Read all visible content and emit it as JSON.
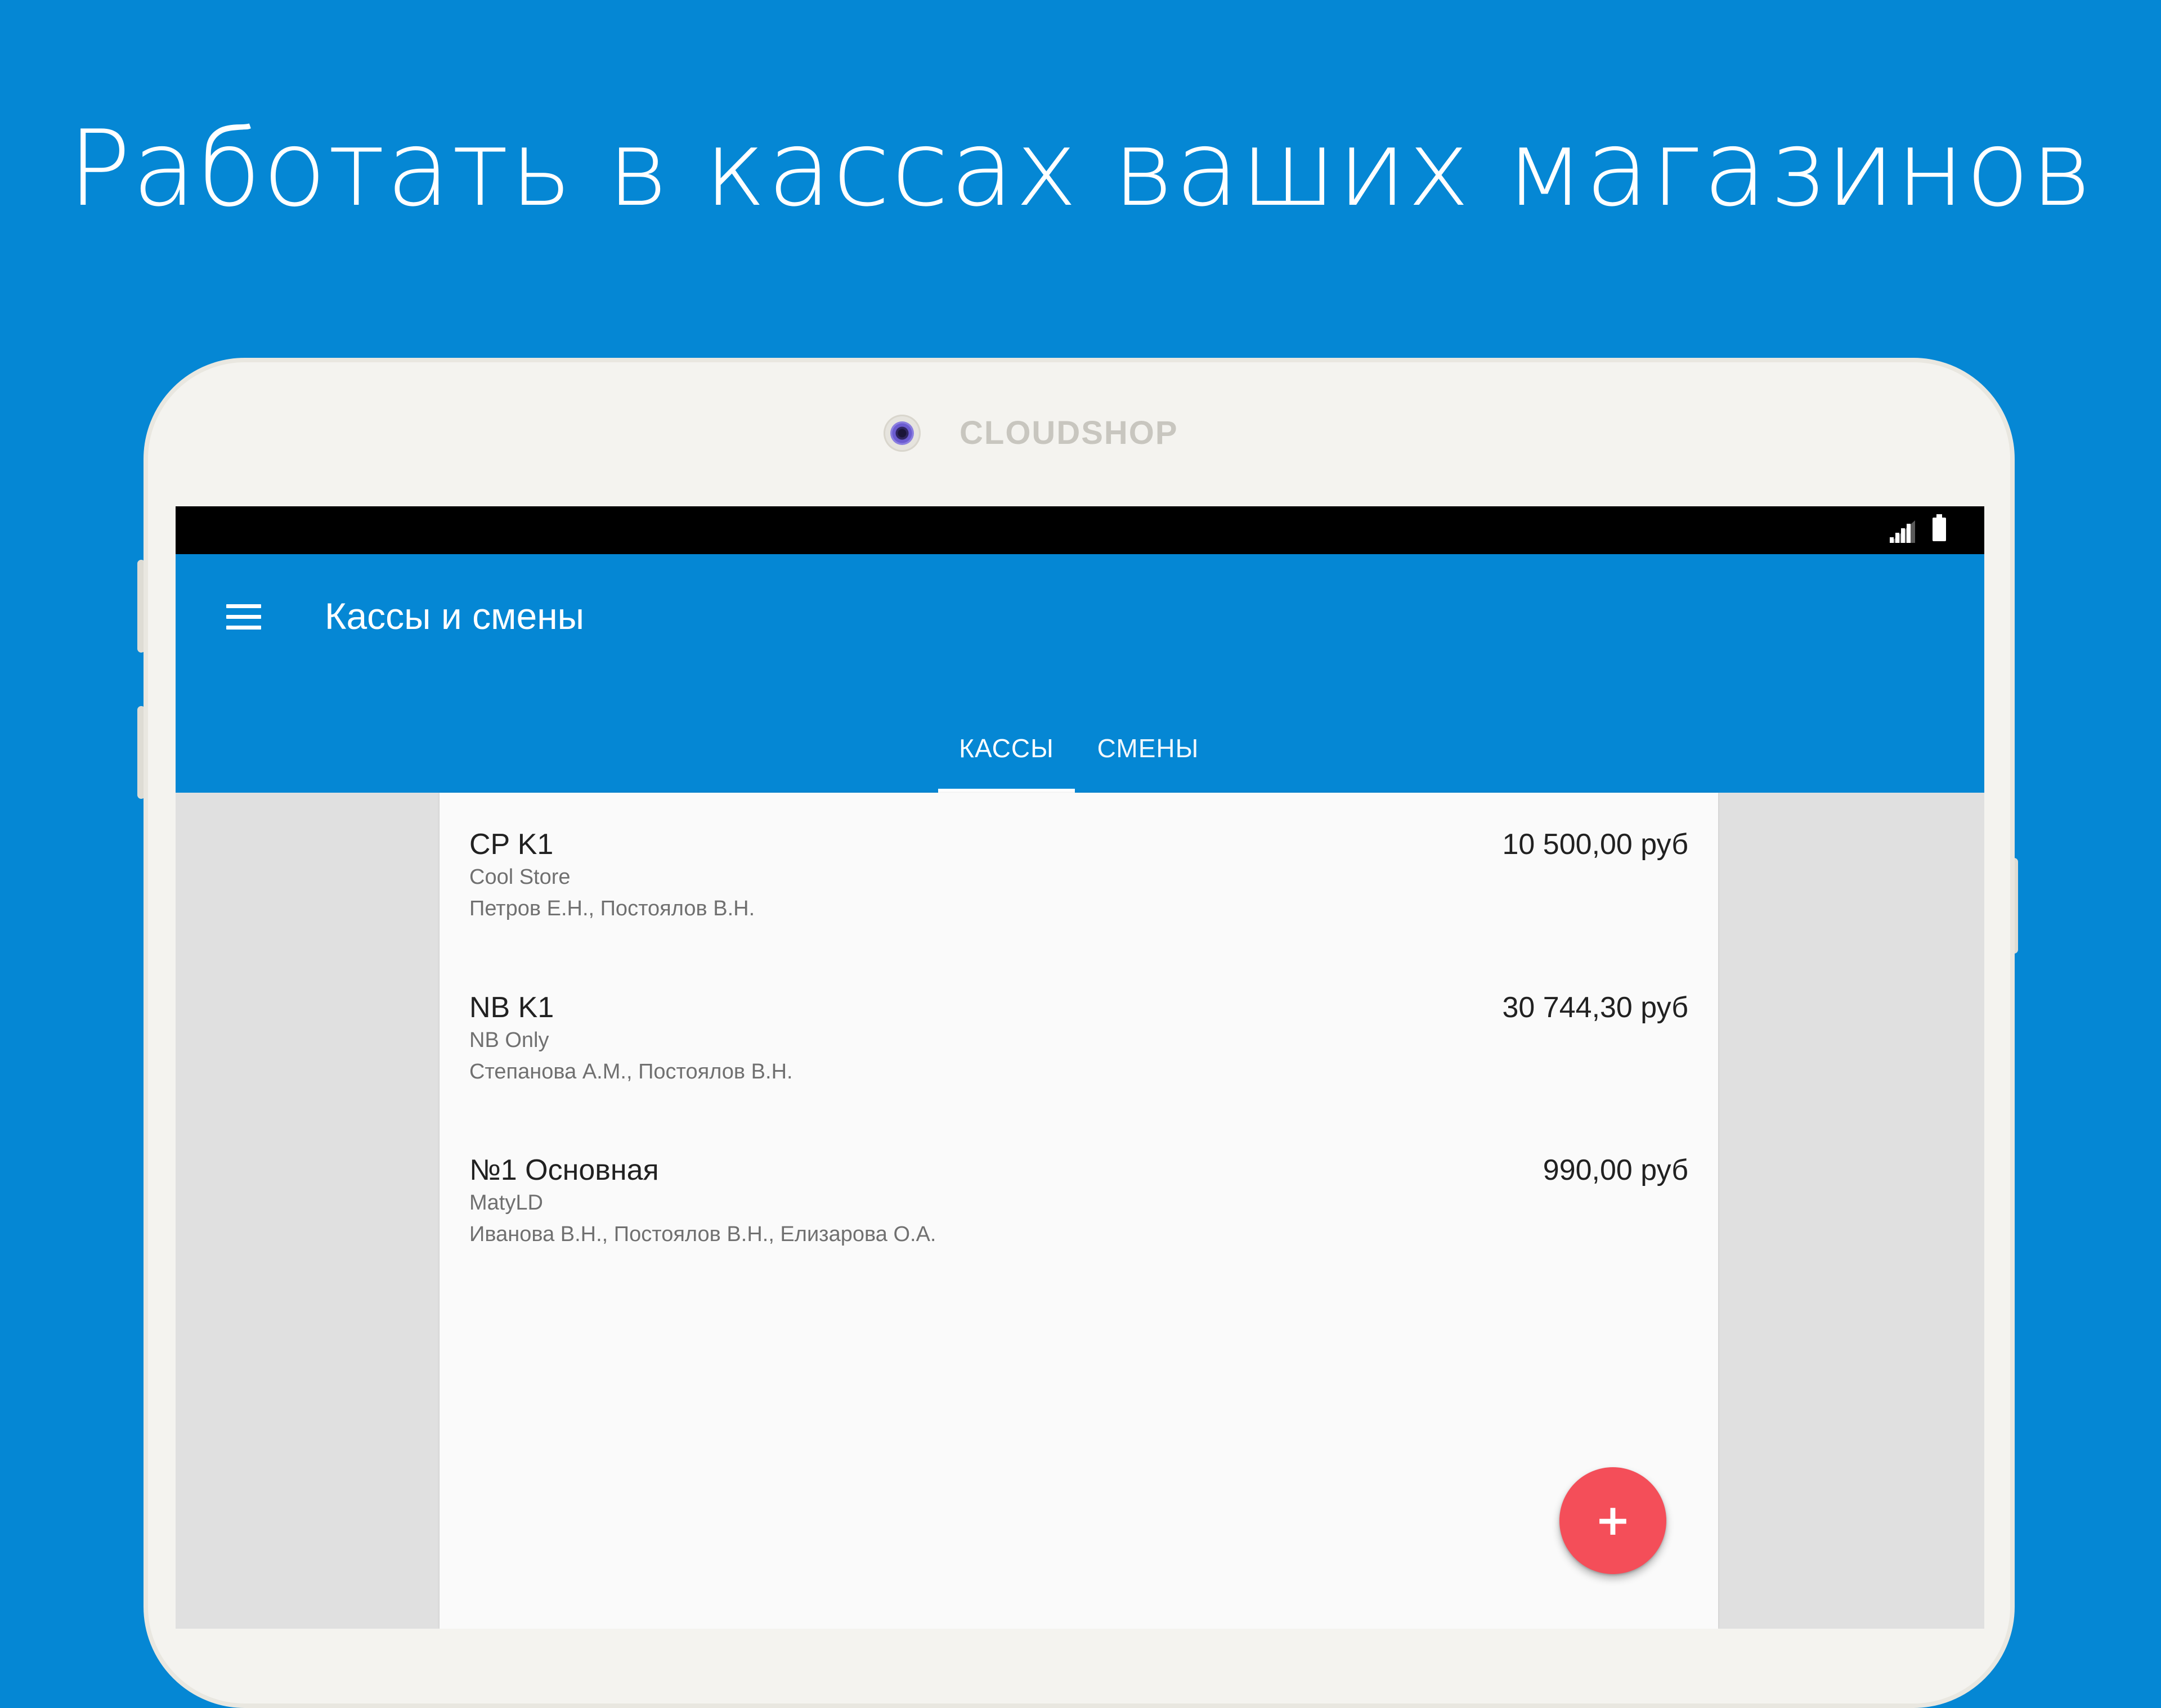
{
  "headline": "Работать в кассах ваших магазинов",
  "device": {
    "brand": "CLOUDSHOP"
  },
  "status_bar": {
    "icons": [
      "signal-icon",
      "battery-icon"
    ]
  },
  "app_bar": {
    "title": "Кассы и смены",
    "menu_icon": "menu-icon",
    "tabs": [
      {
        "label": "КАССЫ",
        "selected": true
      },
      {
        "label": "СМЕНЫ",
        "selected": false
      }
    ]
  },
  "registers": [
    {
      "name": "CP K1",
      "store": "Cool Store",
      "staff": "Петров Е.Н., Постоялов В.Н.",
      "amount": "10 500,00 руб"
    },
    {
      "name": "NB K1",
      "store": "NB Only",
      "staff": "Степанова А.М., Постоялов В.Н.",
      "amount": "30 744,30 руб"
    },
    {
      "name": "№1 Основная",
      "store": "MatyLD",
      "staff": "Иванова В.Н., Постоялов В.Н., Елизарова О.А.",
      "amount": "990,00 руб"
    }
  ],
  "fab": {
    "label": "+",
    "icon": "plus-icon"
  },
  "colors": {
    "background": "#0587d4",
    "app_bar": "#0587d4",
    "fab": "#f44e59",
    "device_frame": "#f4f3ef"
  }
}
